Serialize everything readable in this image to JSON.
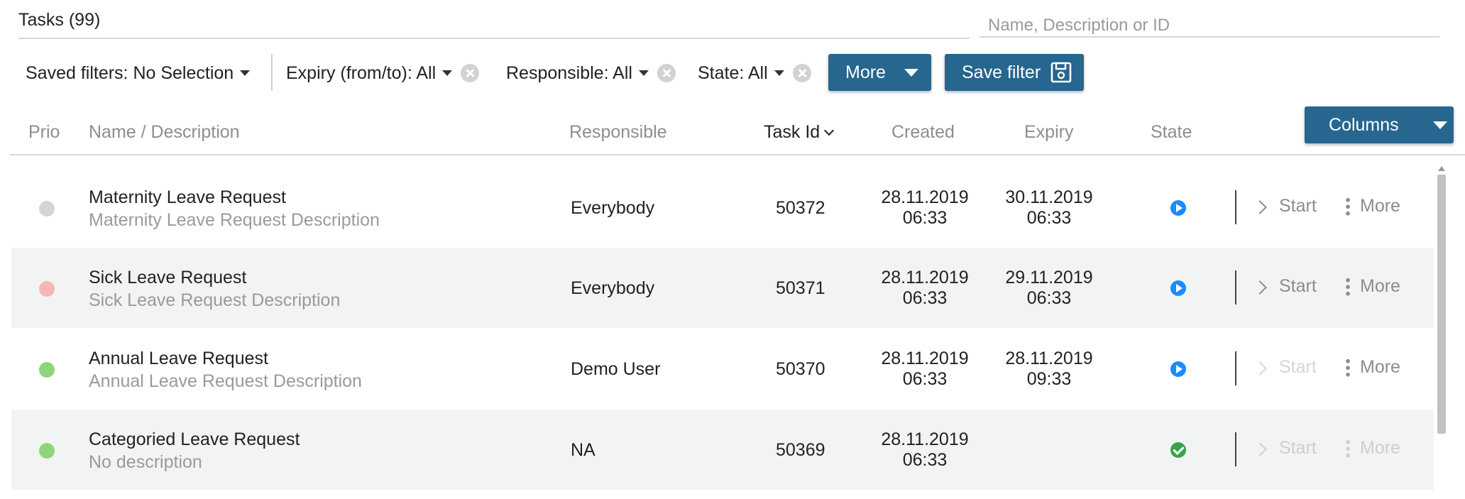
{
  "header": {
    "title": "Tasks (99)",
    "search_placeholder": "Name, Description or ID"
  },
  "filters": {
    "saved": "Saved filters: No Selection",
    "expiry": "Expiry (from/to): All",
    "responsible": "Responsible: All",
    "state": "State: All",
    "more_label": "More",
    "save_filter_label": "Save filter"
  },
  "table": {
    "columns_button": "Columns",
    "headers": {
      "prio": "Prio",
      "name": "Name / Description",
      "responsible": "Responsible",
      "task_id": "Task Id",
      "created": "Created",
      "expiry": "Expiry",
      "state": "State"
    },
    "rows": [
      {
        "prio_color": "#d5d5d5",
        "name": "Maternity Leave Request",
        "description": "Maternity Leave Request Description",
        "responsible": "Everybody",
        "id": "50372",
        "created_date": "28.11.2019",
        "created_time": "06:33",
        "expiry_date": "30.11.2019",
        "expiry_time": "06:33",
        "state_icon": "play-circle-icon",
        "start_label": "Start",
        "more_label": "More"
      },
      {
        "prio_color": "#f7b7b5",
        "name": "Sick Leave Request",
        "description": "Sick Leave Request Description",
        "responsible": "Everybody",
        "id": "50371",
        "created_date": "28.11.2019",
        "created_time": "06:33",
        "expiry_date": "29.11.2019",
        "expiry_time": "06:33",
        "state_icon": "play-circle-icon",
        "start_label": "Start",
        "more_label": "More"
      },
      {
        "prio_color": "#8ed57a",
        "name": "Annual Leave Request",
        "description": "Annual Leave Request Description",
        "responsible": "Demo User",
        "id": "50370",
        "created_date": "28.11.2019",
        "created_time": "06:33",
        "expiry_date": "28.11.2019",
        "expiry_time": "09:33",
        "state_icon": "play-circle-icon",
        "start_label": "Start",
        "more_label": "More"
      },
      {
        "prio_color": "#8ed57a",
        "name": "Categoried Leave Request",
        "description": "No description",
        "responsible": "NA",
        "id": "50369",
        "created_date": "28.11.2019",
        "created_time": "06:33",
        "expiry_date": "",
        "expiry_time": "",
        "state_icon": "check-circle-icon",
        "start_label": "Start",
        "more_label": "More"
      }
    ]
  },
  "colors": {
    "primary_button": "#26668f",
    "state_running": "#1a8cff",
    "state_done": "#3aa34a",
    "row_alt": "#f2f3f3"
  }
}
